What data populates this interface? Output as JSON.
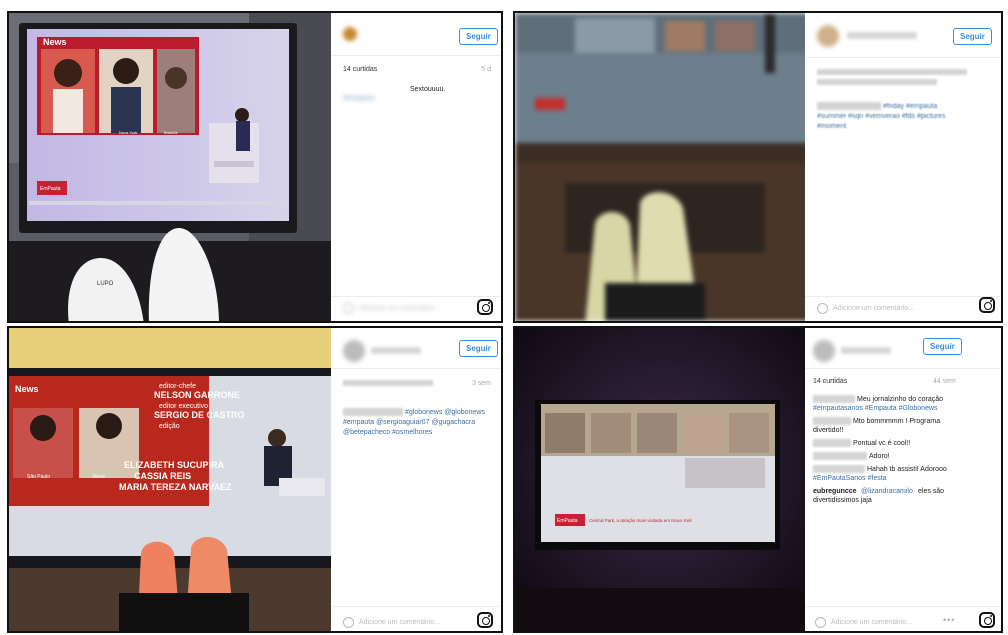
{
  "posts": [
    {
      "follow_label": "Seguir",
      "likes": "14 curtidas",
      "age": "5 d",
      "caption": "Sextouuuu.",
      "tags": "#empauta",
      "comment_placeholder": "Adicione um comentário...",
      "tv": {
        "brand": "News",
        "labels": [
          "Nova York",
          "Brasília"
        ],
        "ticker": "EmPauta"
      }
    },
    {
      "follow_label": "Seguir",
      "tags_line1": "#friday #empauta",
      "tags_line2": "#summer #sqn #vemverao #fds #pictures",
      "tags_line3": "#moment",
      "comment_placeholder": "Adicione um comentário..."
    },
    {
      "follow_label": "Seguir",
      "age": "3 sem",
      "tags_line1": "#globonews @globonews",
      "tags_line2": "#empauta @sergioaguiar07 @gugachacra",
      "tags_line3": "@betepacheco #osmelhores",
      "comment_placeholder": "Adicione um comentário...",
      "tv": {
        "brand": "News",
        "credits": [
          "editor-chefe",
          "NELSON GARRONE",
          "editor executivo",
          "SERGIO DE CASTRO",
          "edição",
          "ELIZABETH SUCUPIRA",
          "CASSIA REIS",
          "MARIA TEREZA NARVAEZ"
        ],
        "labels": [
          "São Paulo",
          "Nova"
        ]
      }
    },
    {
      "follow_label": "Seguir",
      "likes": "14 curtidas",
      "age": "44 sem",
      "comments": [
        {
          "text": "Meu jornalzinho do coração",
          "tags": "#empautasanos #Empauta #Globonews"
        },
        {
          "text": "Mto bommmmm ! Programa",
          "extra": "divertido!!"
        },
        {
          "text": "Pontual vc é cool!!"
        },
        {
          "text": "Adoro!"
        },
        {
          "text": "Hahah tb assisti! Adorooo",
          "tags": "#EmPautaSanos #festa"
        },
        {
          "user": "eubreguncce",
          "mention": "@lizandracamilo",
          "text": "eles são",
          "extra": "divertidissimos jaja"
        }
      ],
      "comment_placeholder": "Adicione um comentário...",
      "more": "•••",
      "tv": {
        "ticker": "EmPauta",
        "caption": "Central Park, a atração mais visitada em Nova York"
      }
    }
  ]
}
